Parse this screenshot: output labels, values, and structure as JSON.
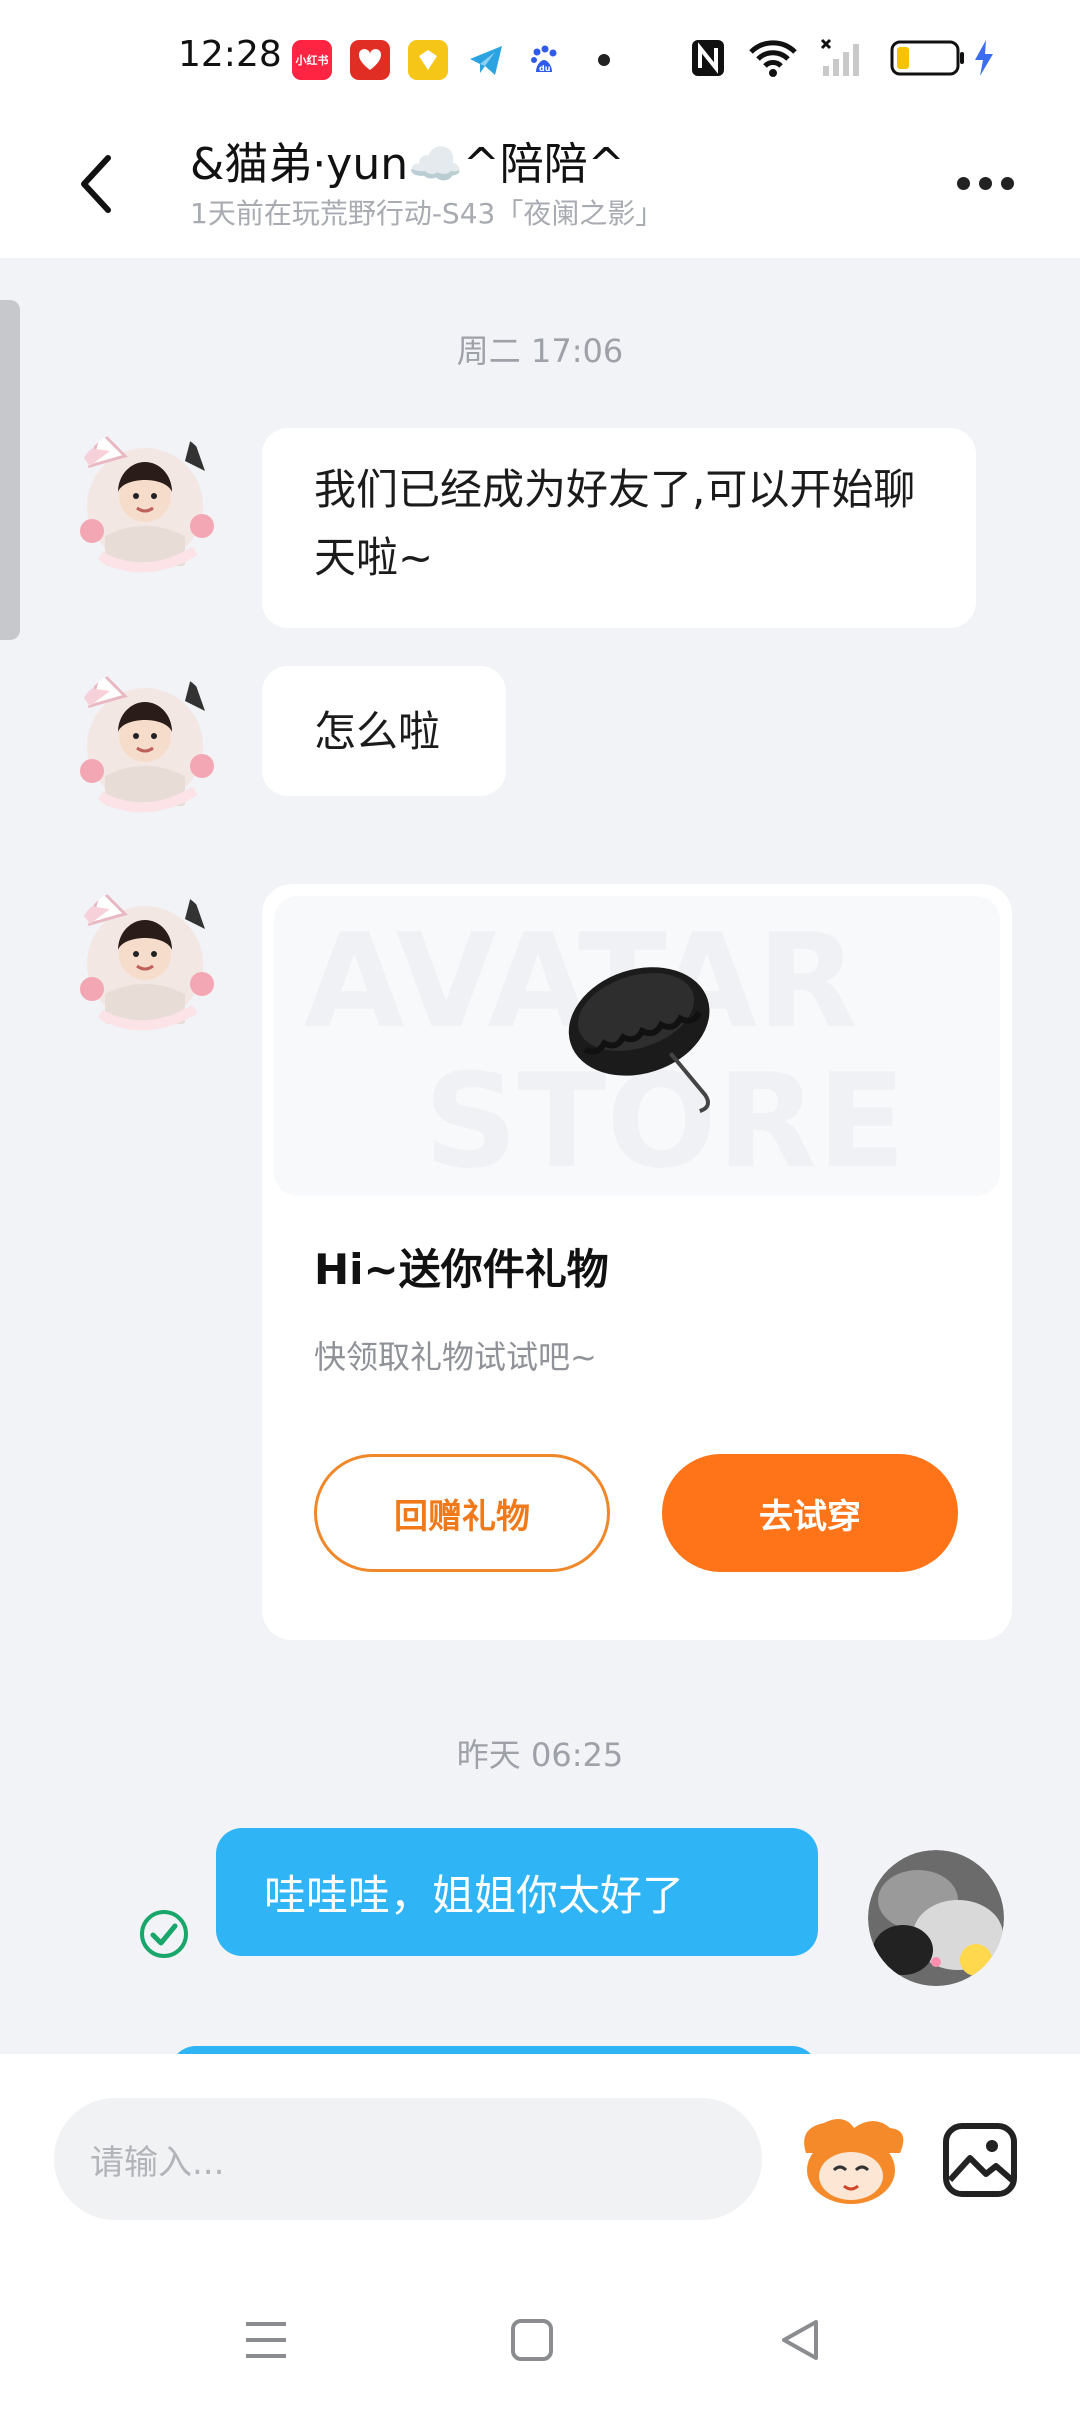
{
  "status_bar": {
    "time": "12:28",
    "app_icons": [
      {
        "name": "xiaohongshu-icon",
        "label": "小红书",
        "color": "#ff2442"
      },
      {
        "name": "pinduoduo-icon",
        "label": "",
        "color": "#e02e24"
      },
      {
        "name": "yellow-app-icon",
        "label": "",
        "color": "#f5c518"
      },
      {
        "name": "telegram-icon",
        "label": "",
        "color": "#2aa3e0"
      },
      {
        "name": "baidu-icon",
        "label": "du",
        "color": "#2f5bea"
      }
    ],
    "battery_color": "#f5c400",
    "charging_color": "#3c6df0"
  },
  "header": {
    "title": "&猫弟·yun☁️^陪陪^",
    "subtitle": "1天前在玩荒野行动-S43「夜阑之影」"
  },
  "messages": {
    "time_1": "周二 17:06",
    "msg_1": "我们已经成为好友了,可以开始聊天啦~",
    "msg_2": "怎么啦",
    "gift": {
      "watermark_line1": "AVATAR",
      "watermark_line2": "STORE",
      "title": "Hi~送你件礼物",
      "desc": "快领取礼物试试吧~",
      "return_gift": "回赠礼物",
      "try_on": "去试穿"
    },
    "time_2": "昨天 06:25",
    "msg_3": "哇哇哇，姐姐你太好了"
  },
  "input": {
    "placeholder": "请输入..."
  },
  "colors": {
    "accent_orange": "#ff7418",
    "bubble_blue": "#2fb4f5",
    "check_green": "#18a66a"
  }
}
